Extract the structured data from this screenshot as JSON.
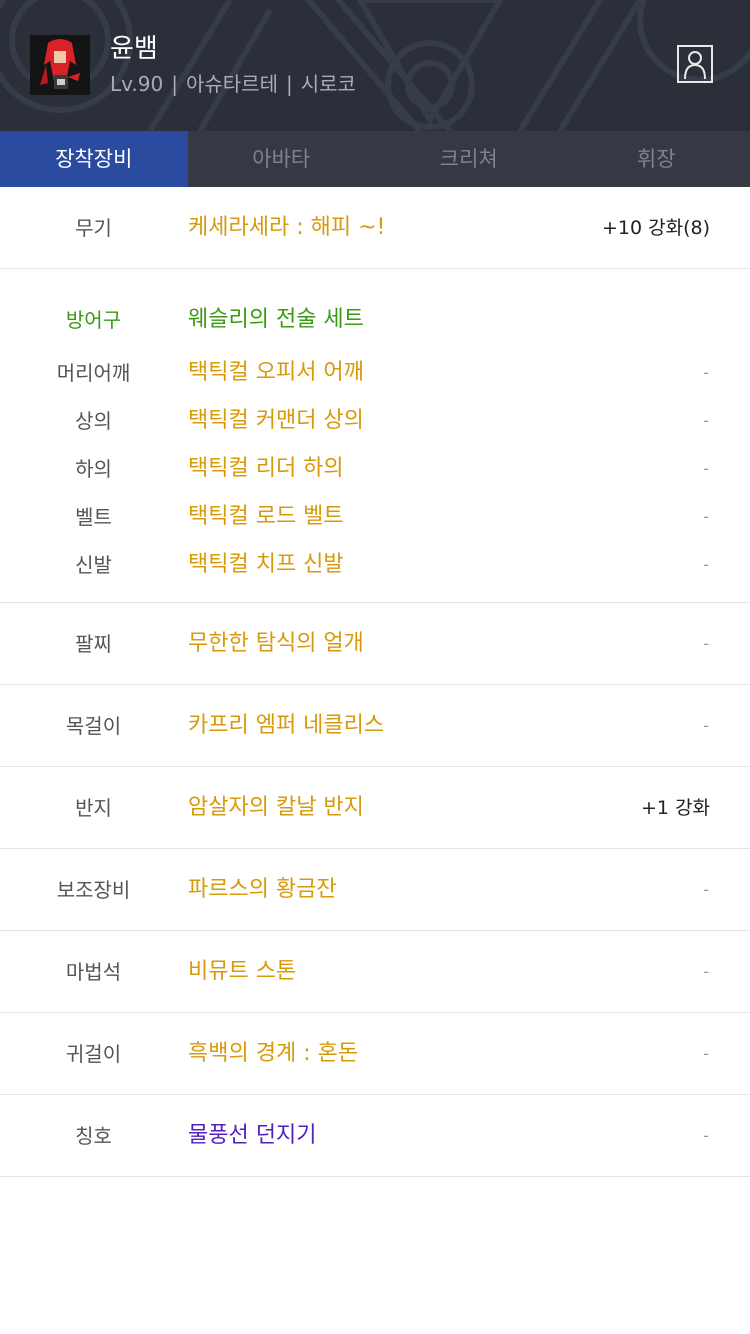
{
  "character": {
    "name": "윤뱀",
    "level": "Lv.90",
    "job": "아슈타르테",
    "guild": "시로코",
    "separator": "|"
  },
  "tabs": [
    {
      "label": "장착장비",
      "active": true
    },
    {
      "label": "아바타",
      "active": false
    },
    {
      "label": "크리쳐",
      "active": false
    },
    {
      "label": "휘장",
      "active": false
    }
  ],
  "weapon": {
    "slot": "무기",
    "name": "케세라세라 : 해피 ~!",
    "enhance": "+10 강화(8)"
  },
  "armor": {
    "set_label": "방어구",
    "set_name": "웨슬리의 전술 세트",
    "items": [
      {
        "slot": "머리어깨",
        "name": "택틱컬 오피서 어깨",
        "enhance": "-"
      },
      {
        "slot": "상의",
        "name": "택틱컬 커맨더 상의",
        "enhance": "-"
      },
      {
        "slot": "하의",
        "name": "택틱컬 리더 하의",
        "enhance": "-"
      },
      {
        "slot": "벨트",
        "name": "택틱컬 로드 벨트",
        "enhance": "-"
      },
      {
        "slot": "신발",
        "name": "택틱컬 치프 신발",
        "enhance": "-"
      }
    ]
  },
  "accessories": [
    {
      "slot": "팔찌",
      "name": "무한한 탐식의 얼개",
      "enhance": "-"
    },
    {
      "slot": "목걸이",
      "name": "카프리 엠퍼 네클리스",
      "enhance": "-"
    },
    {
      "slot": "반지",
      "name": "암살자의 칼날 반지",
      "enhance": "+1 강화"
    },
    {
      "slot": "보조장비",
      "name": "파르스의 황금잔",
      "enhance": "-"
    },
    {
      "slot": "마법석",
      "name": "비뮤트 스톤",
      "enhance": "-"
    },
    {
      "slot": "귀걸이",
      "name": "흑백의 경계 : 혼돈",
      "enhance": "-"
    },
    {
      "slot": "칭호",
      "name": "물풍선 던지기",
      "enhance": "-"
    }
  ],
  "colors": {
    "header_bg": "#2a2f3a",
    "tab_active": "#2b4ba0",
    "unique_item": "#d89a0a",
    "set_item": "#3b9a12",
    "title_item": "#5022c0"
  }
}
